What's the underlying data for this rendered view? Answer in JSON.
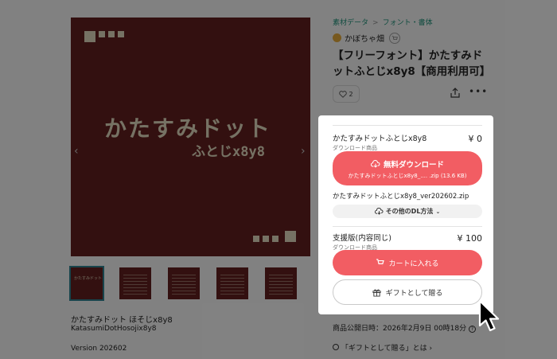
{
  "breadcrumb": {
    "category": "素材データ",
    "separator": ">",
    "subcategory": "フォント・書体"
  },
  "shop": {
    "name": "かぼちゃ畑"
  },
  "product": {
    "title": "【フリーフォント】かたすみドットふとじx8y8【商用利用可】",
    "like_count": "2"
  },
  "image": {
    "logo_title": "かたすみドット",
    "logo_subtitle": "ふとじx8y8"
  },
  "thumbnail": {
    "title": "かたすみドット"
  },
  "description": {
    "title": "かたすみドット ほそじx8y8",
    "subtitle": "KatasumiDotHosojix8y8",
    "version": "Version 202602"
  },
  "panel": {
    "free_item": {
      "name": "かたすみドットふとじx8y8",
      "kind": "ダウンロード商品",
      "price": "¥ 0"
    },
    "download_button": {
      "label": "無料ダウンロード",
      "file": "かたすみドットふとじx8y8_.... .zip (13.6 KB)"
    },
    "file_name": "かたすみドットふとじx8y8_ver202602.zip",
    "other_dl_label": "その他のDL方法",
    "support_item": {
      "name": "支援版(内容同じ)",
      "kind": "ダウンロード商品",
      "price": "¥ 100"
    },
    "cart_button_label": "カートに入れる",
    "gift_button_label": "ギフトとして贈る"
  },
  "meta": {
    "published": "商品公開日時：2026年2月9日 00時18分"
  },
  "gift_info_link": "「ギフトとして贈る」とは",
  "colors": {
    "accent_red": "#f25d63",
    "breadcrumb_green": "#1e8b74",
    "image_bg": "#5e1e1e",
    "pixel_beige": "#d7d0b6"
  },
  "icons": [
    "cloud-download-icon",
    "cart-icon",
    "gift-icon",
    "heart-icon",
    "share-icon",
    "more-icon",
    "chevron-left-icon",
    "chevron-right-icon",
    "chevron-down-icon",
    "clock-icon",
    "question-icon",
    "cursor-icon"
  ]
}
